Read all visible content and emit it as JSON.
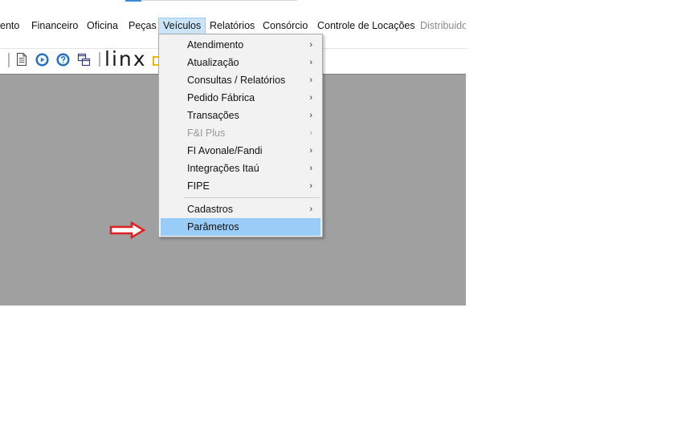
{
  "menubar": {
    "items": [
      {
        "label": "ento"
      },
      {
        "label": "Financeiro"
      },
      {
        "label": "Oficina"
      },
      {
        "label": "Peças"
      },
      {
        "label": "Veículos"
      },
      {
        "label": "Relatórios"
      },
      {
        "label": "Consórcio"
      },
      {
        "label": "Controle de Locações"
      },
      {
        "label": "Distribuido"
      }
    ]
  },
  "toolbar": {
    "logo_text": "linx",
    "icons": [
      "document-icon",
      "play-icon",
      "help-icon",
      "windows-icon"
    ]
  },
  "dropdown": {
    "items": [
      {
        "label": "Atendimento",
        "submenu": true
      },
      {
        "label": "Atualização",
        "submenu": true
      },
      {
        "label": "Consultas / Relatórios",
        "submenu": true
      },
      {
        "label": "Pedido Fábrica",
        "submenu": true
      },
      {
        "label": "Transações",
        "submenu": true
      },
      {
        "label": "F&I Plus",
        "submenu": true,
        "disabled": true
      },
      {
        "label": "FI Avonale/Fandi",
        "submenu": true
      },
      {
        "label": "Integrações Itaú",
        "submenu": true
      },
      {
        "label": "FIPE",
        "submenu": true
      },
      {
        "label": "Cadastros",
        "submenu": true
      },
      {
        "label": "Parâmetros",
        "selected": true
      }
    ],
    "chevron": "›"
  },
  "colors": {
    "workspace": "#a0a0a0",
    "menu_active": "#cce4f7",
    "dropdown_selected": "#99cdf7",
    "arrow": "#e02020",
    "logo_accent": "#f2b800"
  }
}
